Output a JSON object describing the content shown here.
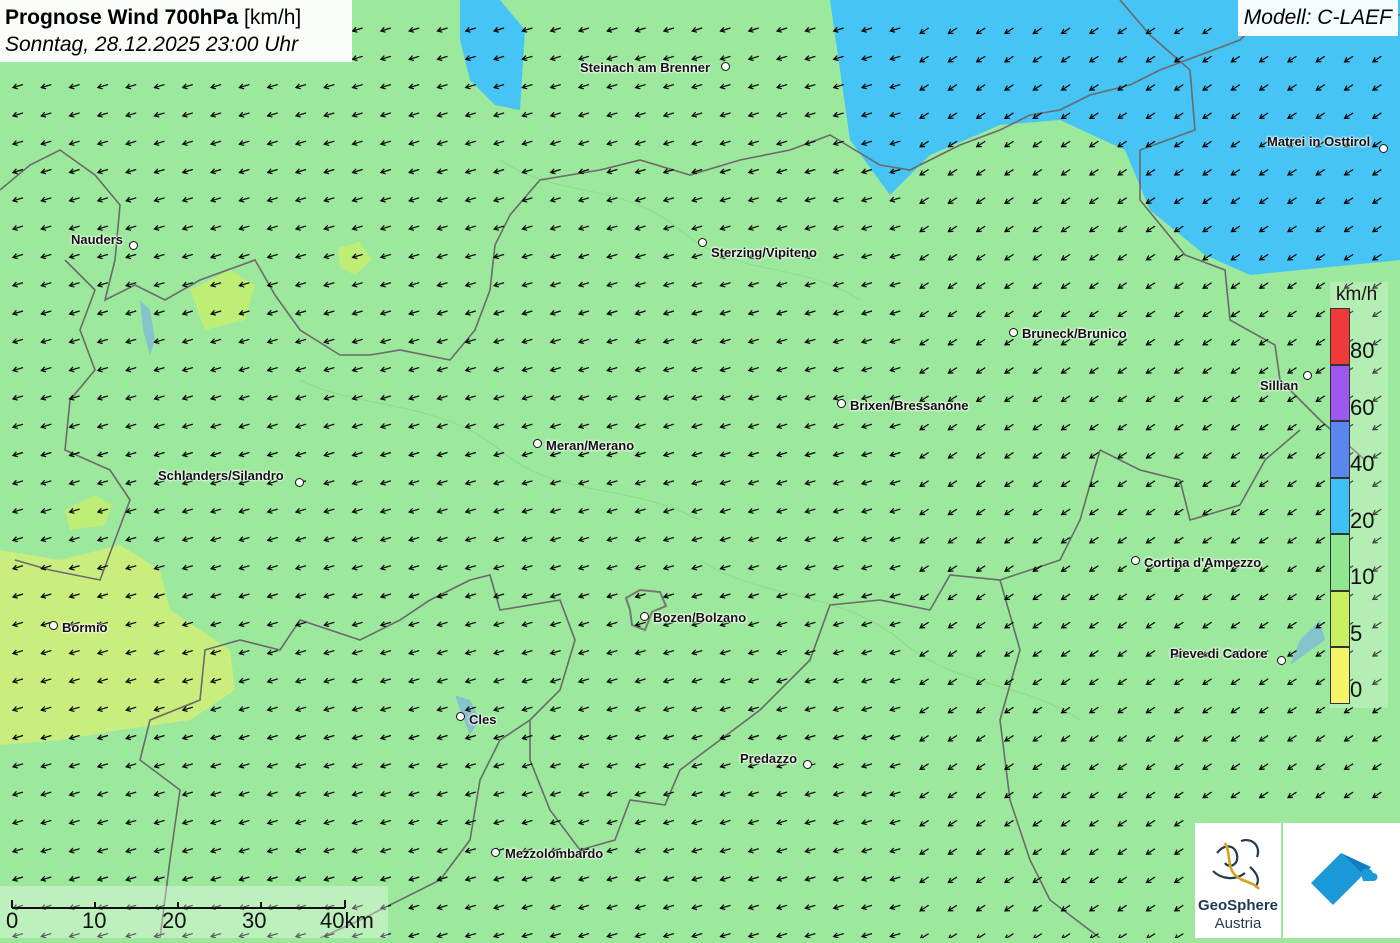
{
  "header": {
    "title_bold": "Prognose Wind 700hPa",
    "title_unit": "[km/h]",
    "subtitle": "Sonntag, 28.12.2025 23:00 Uhr",
    "model": "Modell: C-LAEF"
  },
  "cities": [
    {
      "name": "Steinach am Brenner"
    },
    {
      "name": "Matrei in Osttirol"
    },
    {
      "name": "Nauders"
    },
    {
      "name": "Sterzing/Vipiteno"
    },
    {
      "name": "Bruneck/Brunico"
    },
    {
      "name": "Sillian"
    },
    {
      "name": "Brixen/Bressanone"
    },
    {
      "name": "Meran/Merano"
    },
    {
      "name": "Schlanders/Silandro"
    },
    {
      "name": "Cortina d'Ampezzo"
    },
    {
      "name": "Bormio"
    },
    {
      "name": "Bozen/Bolzano"
    },
    {
      "name": "Pieve di Cadore"
    },
    {
      "name": "Cles"
    },
    {
      "name": "Predazzo"
    },
    {
      "name": "Mezzolombardo"
    }
  ],
  "legend": {
    "unit": "km/h",
    "bins": [
      {
        "label": "80",
        "color": "#f03a3a"
      },
      {
        "label": "60",
        "color": "#9b59f0"
      },
      {
        "label": "40",
        "color": "#5b86f0"
      },
      {
        "label": "20",
        "color": "#3fc0f7"
      },
      {
        "label": "10",
        "color": "#8fe88f"
      },
      {
        "label": "5",
        "color": "#c8f060"
      },
      {
        "label": "0",
        "color": "#f5f56a"
      }
    ]
  },
  "scale": {
    "ticks": [
      "0",
      "10",
      "20",
      "30",
      "40km"
    ]
  },
  "logos": {
    "geosphere_line1": "GeoSphere",
    "geosphere_line2": "Austria"
  },
  "wind": {
    "direction_deg": 225,
    "description": "arrows pointing southwest"
  },
  "colors": {
    "calm": "#f5f56a",
    "light": "#c8f060",
    "moderate": "#9be89b",
    "strong": "#3fc0f7"
  }
}
